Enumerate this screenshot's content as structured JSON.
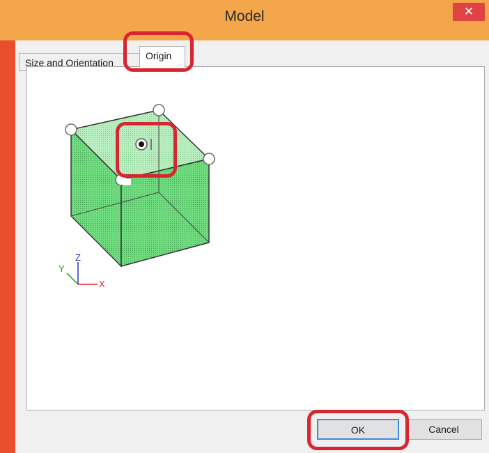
{
  "window": {
    "title": "Model",
    "close_glyph": "✕"
  },
  "tabs": [
    {
      "label": "Size and Orientation",
      "selected": false
    },
    {
      "label": "Origin",
      "selected": true
    }
  ],
  "cube": {
    "fill_color": "#6fdc7f",
    "origin_selected": "top-center"
  },
  "axes": {
    "x": {
      "label": "X",
      "color": "#e12020"
    },
    "y": {
      "label": "Y",
      "color": "#1a9a1a"
    },
    "z": {
      "label": "Z",
      "color": "#2233cc"
    }
  },
  "buttons": {
    "ok_label": "OK",
    "cancel_label": "Cancel"
  },
  "highlight_color": "#d7262f"
}
